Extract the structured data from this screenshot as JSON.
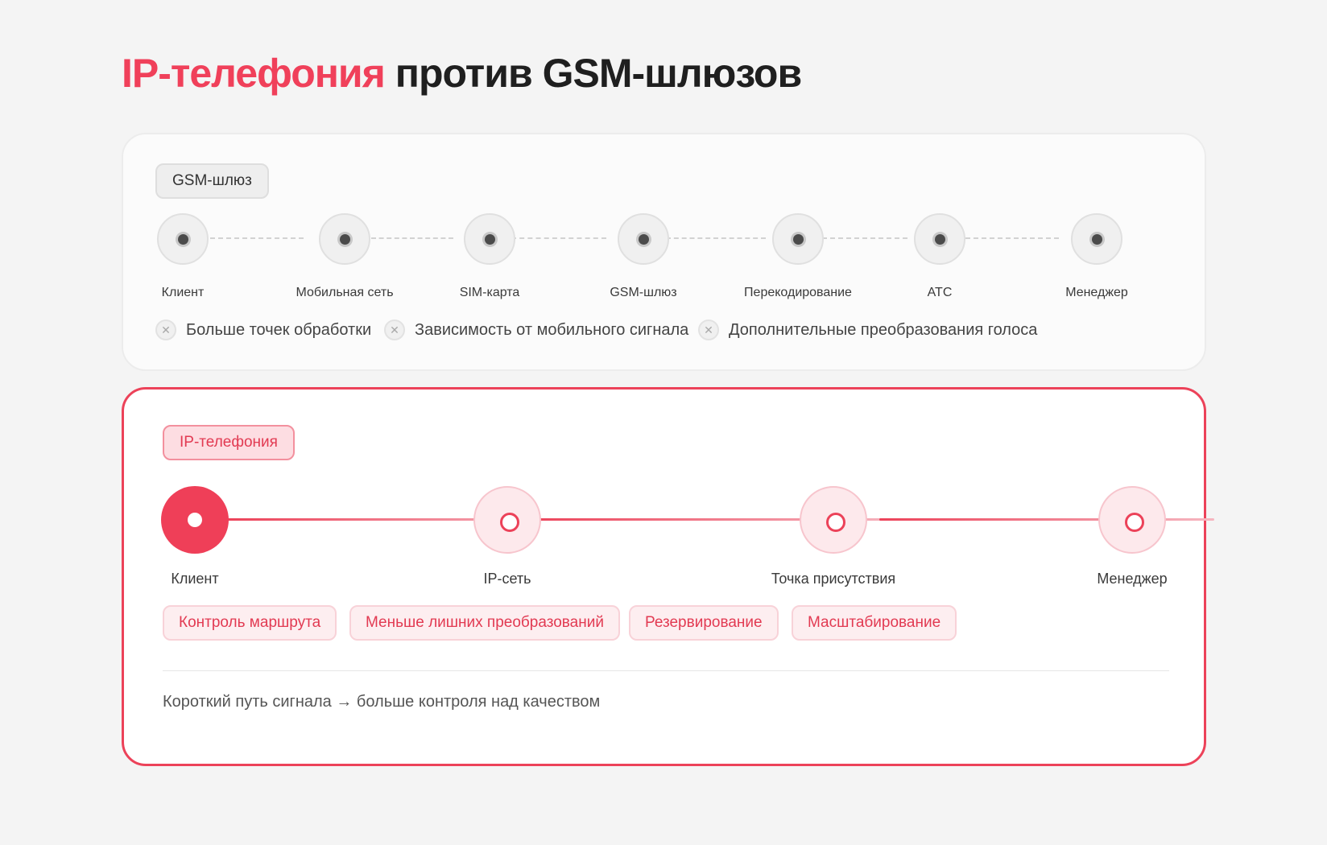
{
  "title": {
    "accent": "IP-телефония",
    "rest": "против GSM-шлюзов"
  },
  "gsm": {
    "label": "GSM-шлюз",
    "nodes": [
      "Клиент",
      "Мобильная сеть",
      "SIM-карта",
      "GSM-шлюз",
      "Перекодирование",
      "АТС",
      "Менеджер"
    ],
    "disadvantages": [
      "Больше точек обработки",
      "Зависимость от мобильного сигнала",
      "Дополнительные преобразования голоса"
    ],
    "disadvantage_icon": "x-circle-icon"
  },
  "ip": {
    "label": "IP-телефония",
    "nodes": [
      "Клиент",
      "IP-сеть",
      "Точка присутствия",
      "Менеджер"
    ],
    "advantages": [
      "Контроль маршрута",
      "Меньше лишних преобразований",
      "Резервирование",
      "Масштабирование"
    ],
    "summary": "Короткий путь сигнала → больше контроля над качеством"
  },
  "colors": {
    "accent": "#ef3f58",
    "background": "#f4f4f4"
  }
}
